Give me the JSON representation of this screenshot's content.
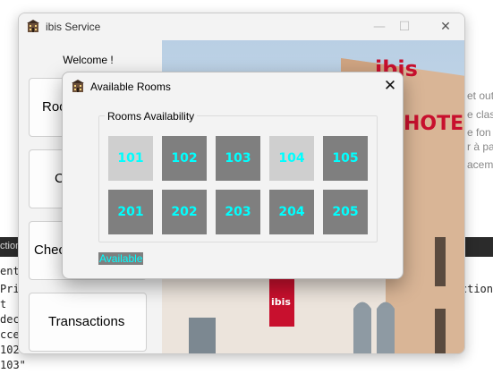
{
  "background_console": {
    "bar_text": "ction",
    "lines": [
      "ent_",
      "Pri",
      "t",
      "dec",
      "cce",
      "102",
      "103\""
    ],
    "right_line": "ction",
    "right_gray_lines": [
      "et out",
      "e clas",
      "e fon",
      "r à pa",
      "acem"
    ]
  },
  "main_window": {
    "title": "ibis Service",
    "controls": {
      "minimize": "—",
      "maximize": "☐",
      "close": "✕"
    },
    "sidebar": {
      "welcome": "Welcome !",
      "buttons": [
        {
          "label": "Rooms",
          "visible_text": "Roo"
        },
        {
          "label": "Check In",
          "visible_text": "Ch"
        },
        {
          "label": "Check Out",
          "visible_text": "Chec"
        },
        {
          "label": "Transactions",
          "visible_text": "Transactions"
        }
      ]
    },
    "hotel_sign": "ibis HOTEL",
    "hotel_small_sign": "ibis"
  },
  "dialog": {
    "title": "Available Rooms",
    "close": "✕",
    "group_title": "Rooms Availability",
    "rooms": [
      {
        "number": "101",
        "status": "available"
      },
      {
        "number": "102",
        "status": "occupied"
      },
      {
        "number": "103",
        "status": "occupied"
      },
      {
        "number": "104",
        "status": "available"
      },
      {
        "number": "105",
        "status": "occupied"
      },
      {
        "number": "201",
        "status": "occupied"
      },
      {
        "number": "202",
        "status": "occupied"
      },
      {
        "number": "203",
        "status": "occupied"
      },
      {
        "number": "204",
        "status": "occupied"
      },
      {
        "number": "205",
        "status": "occupied"
      }
    ],
    "legend_label": "Available"
  },
  "colors": {
    "occupied_tile": "#7f7f7f",
    "available_tile": "#cfcfcf",
    "room_text": "#00ffff",
    "ibis_red": "#c8102e"
  }
}
